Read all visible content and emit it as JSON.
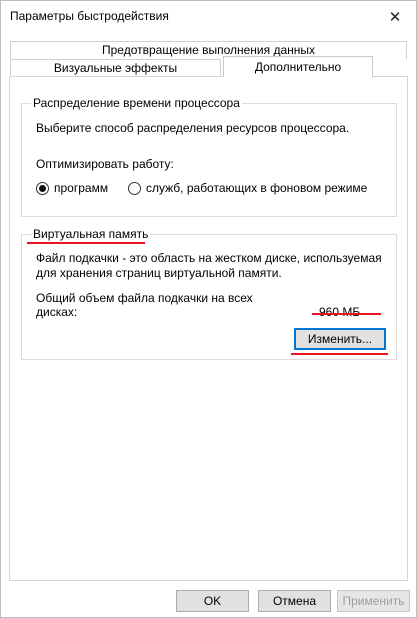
{
  "window": {
    "title": "Параметры быстродействия"
  },
  "tabs": {
    "row_top": [
      {
        "label": "Предотвращение выполнения данных"
      }
    ],
    "row_bottom": [
      {
        "label": "Визуальные эффекты"
      },
      {
        "label": "Дополнительно",
        "active": true
      }
    ]
  },
  "processor": {
    "group_title": "Распределение времени процессора",
    "description": "Выберите способ распределения ресурсов процессора.",
    "optimize_label": "Оптимизировать работу:",
    "options": [
      {
        "label": "программ",
        "checked": true
      },
      {
        "label": "служб, работающих в фоновом режиме",
        "checked": false
      }
    ]
  },
  "virtual_memory": {
    "group_title": "Виртуальная память",
    "description_line1": "Файл подкачки - это область на жестком диске, используемая",
    "description_line2": "для хранения страниц виртуальной памяти.",
    "total_label_line1": "Общий объем файла подкачки на всех",
    "total_label_line2": "дисках:",
    "total_value": "960 МБ",
    "change_button": "Изменить..."
  },
  "footer": {
    "ok": "OK",
    "cancel": "Отмена",
    "apply": "Применить"
  },
  "annotation_color": "#e8141e"
}
